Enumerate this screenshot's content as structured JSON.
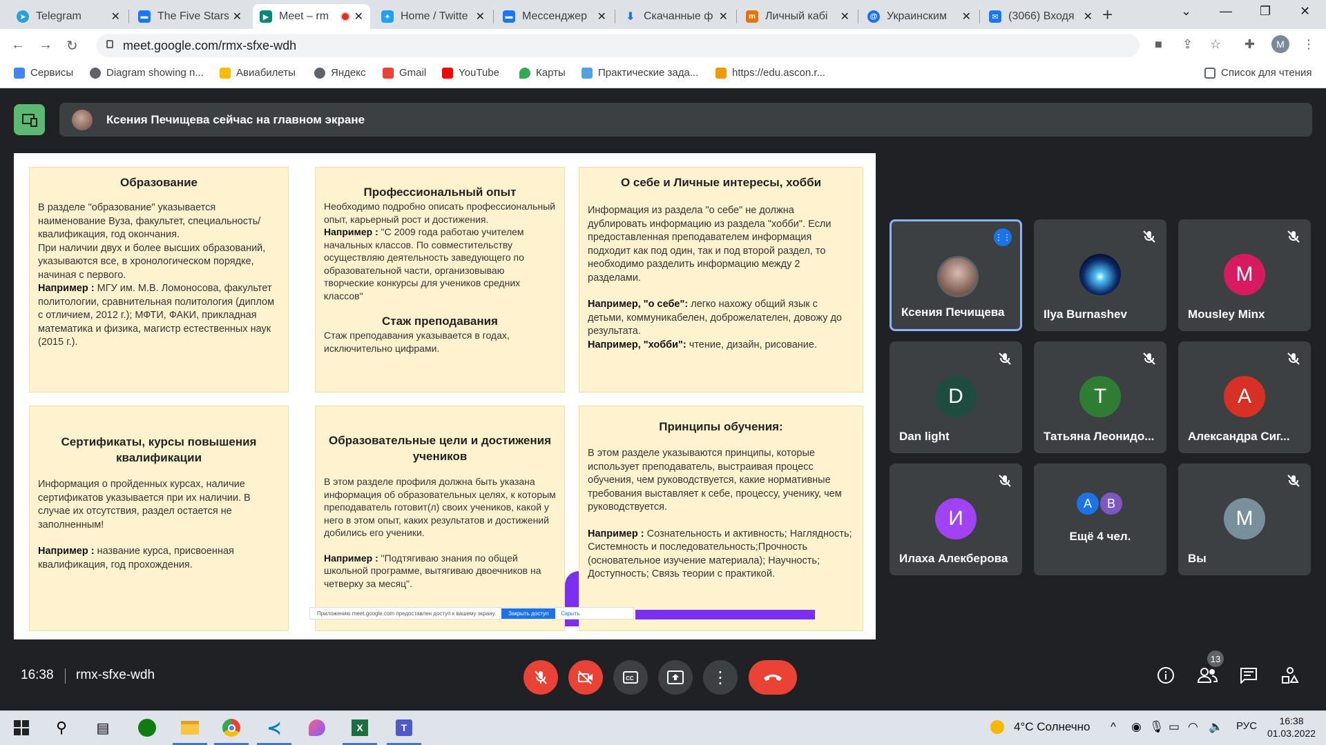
{
  "browser": {
    "tabs": [
      {
        "title": "Telegram",
        "icon": "telegram-icon",
        "color": "#2aa1da"
      },
      {
        "title": "The Five Stars",
        "icon": "chat-icon",
        "color": "#1877f2"
      },
      {
        "title": "Meet – rm",
        "icon": "meet-icon",
        "color": "#00897b",
        "active": true
      },
      {
        "title": "Home / Twitte",
        "icon": "twitter-icon",
        "color": "#1da1f2"
      },
      {
        "title": "Мессенджер",
        "icon": "messenger-icon",
        "color": "#1877f2"
      },
      {
        "title": "Скачанные ф",
        "icon": "download-icon",
        "color": "#1a73e8"
      },
      {
        "title": "Личный кабі",
        "icon": "cabinet-icon",
        "color": "#e8710a"
      },
      {
        "title": "Украинским",
        "icon": "site-icon",
        "color": "#1a73e8"
      },
      {
        "title": "(3066) Входя",
        "icon": "mail-icon",
        "color": "#1877f2"
      }
    ],
    "url": "meet.google.com/rmx-sfxe-wdh",
    "profile_initial": "M",
    "bookmarks": [
      {
        "label": "Сервисы",
        "color": "#4285f4"
      },
      {
        "label": "Diagram showing n...",
        "color": "#5f6368"
      },
      {
        "label": "Авиабилеты",
        "color": "#fbbc04"
      },
      {
        "label": "Яндекс",
        "color": "#5f6368"
      },
      {
        "label": "Gmail",
        "color": "#ea4335"
      },
      {
        "label": "YouTube",
        "color": "#ff0000"
      },
      {
        "label": "Карты",
        "color": "#34a853"
      },
      {
        "label": "Практические зада...",
        "color": "#4fa3e0"
      },
      {
        "label": "https://edu.ascon.r...",
        "color": "#f29900"
      }
    ],
    "reading_list": "Список для чтения"
  },
  "meet": {
    "presenter_banner": "Ксения Печищева сейчас на главном экране",
    "slide": {
      "cards": [
        {
          "title": "Образование",
          "paragraphs": [
            {
              "text": "В разделе \"образование\" указывается наименование Вуза, факультет, специальность/квалификация, год окончания."
            },
            {
              "text": "При наличии двух и более высших образований, указываются все, в хронологическом порядке, начиная с первого."
            },
            {
              "bold": "Например : ",
              "text": "МГУ им. М.В. Ломоносова, факультет политологии, сравнительная политология (диплом с отличием, 2012 г.); МФТИ, ФАКИ, прикладная математика и физика, магистр естественных наук (2015 г.)."
            }
          ]
        },
        {
          "title": "Профессиональный опыт",
          "paragraphs": [
            {
              "text": "Необходимо подробно описать профессиональный опыт, карьерный рост и достижения."
            },
            {
              "bold": "Например : ",
              "text": "\"С 2009 года работаю учителем начальных классов. По совместительству осуществляю деятельность заведующего по образовательной части, организовываю творческие конкурсы для учеников средних классов\""
            }
          ],
          "subtitle": "Стаж преподавания",
          "subtext": "Стаж преподавания указывается в годах, исключительно цифрами."
        },
        {
          "title": "О себе и Личные интересы, хобби",
          "paragraphs": [
            {
              "text": "Информация из раздела \"о себе\" не должна дублировать информацию из раздела \"хобби\". Если предоставленная преподавателем информация подходит как под один, так и под второй раздел, то необходимо разделить информацию между 2 разделами."
            },
            {
              "bold": "Например, \"о себе\": ",
              "text": "легко нахожу общий язык с детьми, коммуникабелен, доброжелателен, довожу до результата."
            },
            {
              "bold": "Например, \"хобби\": ",
              "text": "чтение, дизайн, рисование."
            }
          ]
        },
        {
          "title": "Сертификаты, курсы повышения квалификации",
          "paragraphs": [
            {
              "text": "Информация о пройденных курсах, наличие сертификатов указывается при их наличии. В случае их отсутствия, раздел остается не заполненным!"
            },
            {
              "bold": "Например : ",
              "text": "название курса, присвоенная квалификация, год прохождения."
            }
          ]
        },
        {
          "title": "Образовательные цели и достижения учеников",
          "paragraphs": [
            {
              "text": "В этом разделе профиля должна быть указана информация об образовательных целях, к которым преподаватель готовит(л) своих учеников, какой у него в этом опыт, каких результатов и достижений добились его ученики."
            },
            {
              "bold": "Например : ",
              "text": "\"Подтягиваю знания по общей школьной программе, вытягиваю двоечников на четверку за месяц\"."
            }
          ]
        },
        {
          "title": "Принципы обучения:",
          "paragraphs": [
            {
              "text": "В этом разделе указываются принципы, которые использует преподаватель, выстраивая процесс обучения, чем руководствуется, какие нормативные требования выставляет к себе, процессу, ученику, чем руководствуется."
            },
            {
              "bold": "Например : ",
              "text": "Сознательность и активность; Наглядность; Системность и последовательность;Прочность (основательное изучение материала); Научность; Доступность; Связь теории с практикой."
            }
          ]
        }
      ],
      "share_notice": "Приложению meet.google.com предоставлен доступ к вашему экрану.",
      "share_stop": "Закрыть доступ",
      "share_hide": "Скрыть"
    },
    "participants": [
      {
        "name": "Ксения Печищева",
        "initial": "",
        "color": "#8a6a5e",
        "speaking": true
      },
      {
        "name": "Ilya Burnashev",
        "initial": "",
        "color": "#0b2a6b",
        "muted": true
      },
      {
        "name": "Mousley Minx",
        "initial": "M",
        "color": "#d81b60",
        "muted": true
      },
      {
        "name": "Dan light",
        "initial": "D",
        "color": "#1e4d40",
        "muted": true
      },
      {
        "name": "Татьяна Леонидо...",
        "initial": "T",
        "color": "#2e7d32",
        "muted": true
      },
      {
        "name": "Александра Сиг...",
        "initial": "А",
        "color": "#d93025",
        "muted": true
      },
      {
        "name": "Илаха Алекберова",
        "initial": "И",
        "color": "#a142f4",
        "muted": true
      },
      {
        "name": "Ещё 4 чел.",
        "initial_a": "A",
        "initial_b": "B",
        "color_a": "#1a73e8",
        "color_b": "#7e57c2"
      },
      {
        "name": "Вы",
        "initial": "M",
        "color": "#78909c",
        "muted": true
      }
    ],
    "time": "16:38",
    "meeting_code": "rmx-sfxe-wdh",
    "people_count": "13"
  },
  "taskbar": {
    "weather": "4°C  Солнечно",
    "lang": "РУС",
    "time": "16:38",
    "date": "01.03.2022"
  }
}
